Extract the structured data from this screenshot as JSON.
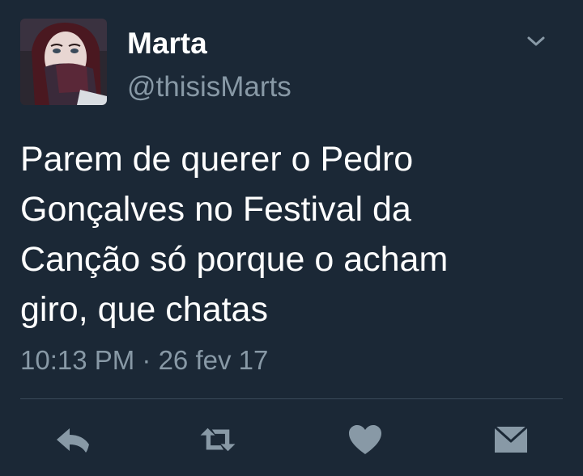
{
  "tweet": {
    "author_name": "Marta",
    "author_handle": "@thisisMarts",
    "text": "Parem de querer o Pedro\nGonçalves no Festival da\nCanção só porque o acham\ngiro, que chatas",
    "timestamp": "10:13 PM · 26 fev 17"
  },
  "icons": {
    "menu": "chevron-down-icon",
    "reply": "reply-icon",
    "retweet": "retweet-icon",
    "like": "heart-icon",
    "message": "envelope-icon"
  },
  "colors": {
    "background": "#1b2836",
    "primary_text": "#ffffff",
    "secondary_text": "#8899a6",
    "icon": "#8899a6",
    "divider": "#3b4a5a"
  }
}
